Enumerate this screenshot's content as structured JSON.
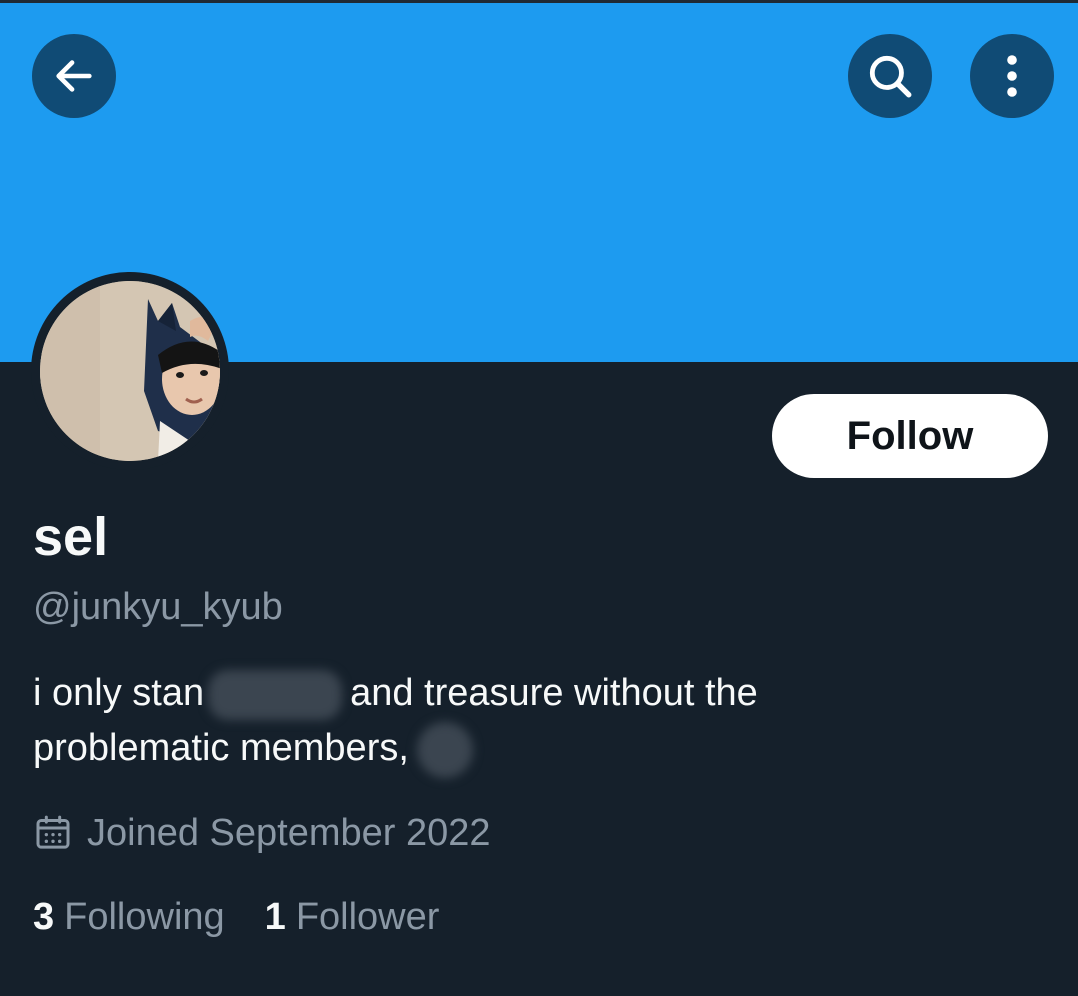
{
  "header": {
    "back_icon": "arrow-left-icon",
    "search_icon": "search-icon",
    "more_icon": "more-vertical-icon",
    "banner_color": "#1d9bf0"
  },
  "profile": {
    "display_name": "sel",
    "handle": "@junkyu_kyub",
    "follow_label": "Follow",
    "bio": {
      "part1": "i only stan",
      "part2": "and treasure without the",
      "part3": "problematic members,"
    },
    "joined": "Joined September 2022",
    "joined_icon": "calendar-icon",
    "following_count": "3",
    "following_label": "Following",
    "followers_count": "1",
    "followers_label": "Follower"
  },
  "colors": {
    "background": "#15202b",
    "accent": "#1d9bf0",
    "text_primary": "#f7f9f9",
    "text_secondary": "#8b98a5"
  }
}
